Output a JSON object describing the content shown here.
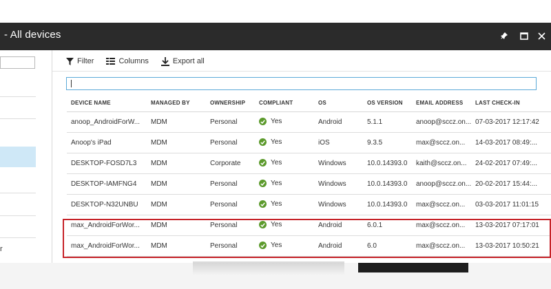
{
  "window": {
    "title": "- All devices",
    "icons": [
      "pin-icon",
      "maximize-icon",
      "close-icon"
    ]
  },
  "left_pane": {
    "partial_text": "r"
  },
  "toolbar": {
    "filter_label": "Filter",
    "columns_label": "Columns",
    "export_label": "Export all"
  },
  "search": {
    "value": "",
    "placeholder": ""
  },
  "table": {
    "columns": [
      "DEVICE NAME",
      "MANAGED BY",
      "OWNERSHIP",
      "COMPLIANT",
      "OS",
      "OS VERSION",
      "EMAIL ADDRESS",
      "LAST CHECK-IN"
    ],
    "rows": [
      [
        "anoop_AndroidForW...",
        "MDM",
        "Personal",
        "Yes",
        "Android",
        "5.1.1",
        "anoop@sccz.on...",
        "07-03-2017 12:17:42"
      ],
      [
        "Anoop's iPad",
        "MDM",
        "Personal",
        "Yes",
        "iOS",
        "9.3.5",
        "max@sccz.on...",
        "14-03-2017 08:49:..."
      ],
      [
        "DESKTOP-FOSD7L3",
        "MDM",
        "Corporate",
        "Yes",
        "Windows",
        "10.0.14393.0",
        "kaith@sccz.on...",
        "24-02-2017 07:49:..."
      ],
      [
        "DESKTOP-IAMFNG4",
        "MDM",
        "Personal",
        "Yes",
        "Windows",
        "10.0.14393.0",
        "anoop@sccz.on...",
        "20-02-2017 15:44:..."
      ],
      [
        "DESKTOP-N32UNBU",
        "MDM",
        "Personal",
        "Yes",
        "Windows",
        "10.0.14393.0",
        "max@sccz.on...",
        "03-03-2017 11:01:15"
      ],
      [
        "max_AndroidForWor...",
        "MDM",
        "Personal",
        "Yes",
        "Android",
        "6.0.1",
        "max@sccz.on...",
        "13-03-2017 07:17:01"
      ],
      [
        "max_AndroidForWor...",
        "MDM",
        "Personal",
        "Yes",
        "Android",
        "6.0",
        "max@sccz.on...",
        "13-03-2017 10:50:21"
      ]
    ],
    "highlighted_rows": [
      5,
      6
    ]
  },
  "colors": {
    "titlebar": "#2b2b2b",
    "accent": "#5aa9d8",
    "compliant": "#5c9a2c",
    "highlight": "#c62127",
    "selected_item": "#cfe8f7"
  }
}
